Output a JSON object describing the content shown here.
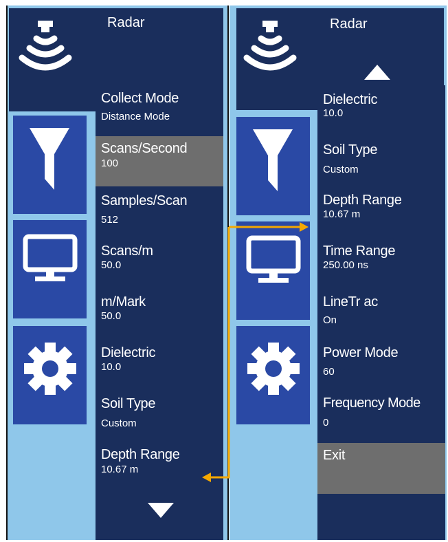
{
  "left_panel": {
    "title": "Radar",
    "items": [
      {
        "label": "Collect Mode",
        "value": "Distance Mode"
      },
      {
        "label": "Scans/Second",
        "value": "100"
      },
      {
        "label": "Samples/Scan",
        "value": "512"
      },
      {
        "label": "Scans/m",
        "value": "50.0"
      },
      {
        "label": "m/Mark",
        "value": "50.0"
      },
      {
        "label": "Dielectric",
        "value": "10.0"
      },
      {
        "label": "Soil Type",
        "value": "Custom"
      },
      {
        "label": "Depth Range",
        "value": "10.67 m"
      }
    ],
    "selected_index": 1
  },
  "right_panel": {
    "title": "Radar",
    "items": [
      {
        "label": "Dielectric",
        "value": "10.0"
      },
      {
        "label": "Soil Type",
        "value": "Custom"
      },
      {
        "label": "Depth Range",
        "value": "10.67 m"
      },
      {
        "label": "Time Range",
        "value": "250.00 ns"
      },
      {
        "label": "LineTr ac",
        "value": "On"
      },
      {
        "label": "Power Mode",
        "value": "60"
      },
      {
        "label": "Frequency Mode",
        "value": "0"
      },
      {
        "label": "Exit",
        "value": ""
      }
    ],
    "selected_index": 7
  },
  "icons": {
    "header": "radar-icon",
    "sidebar": [
      "filter-icon",
      "monitor-icon",
      "gear-icon"
    ],
    "scroll_down": "scroll-down-arrow-icon",
    "scroll_up": "scroll-up-arrow-icon"
  },
  "colors": {
    "panel_bg": "#8fc7ea",
    "menu_bg": "#1a2e5c",
    "icon_button_bg": "#2a49a5",
    "selected_bg": "#6e6e6e",
    "annotation_arrow": "#f5a800"
  }
}
